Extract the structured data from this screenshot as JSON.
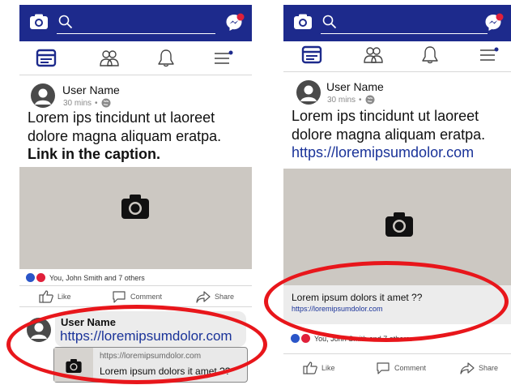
{
  "left": {
    "post": {
      "user_name": "User Name",
      "time": "30 mins",
      "dot": "•",
      "text_line1": "Lorem ips tincidunt ut laoreet",
      "text_line2": "dolore magna aliquam eratpa.",
      "caption_line": "Link in the caption.",
      "reactions": "You, John Smith and 7 others",
      "like_label": "Like",
      "comment_label": "Comment",
      "share_label": "Share"
    },
    "comment": {
      "user_name": "User Name",
      "link": "https://loremipsumdolor.com",
      "preview_url": "https://loremipsumdolor.com",
      "preview_title": "Lorem ipsum dolors it amet ??"
    }
  },
  "right": {
    "post": {
      "user_name": "User Name",
      "time": "30 mins",
      "dot": "•",
      "text_line1": "Lorem ips tincidunt ut laoreet",
      "text_line2": "dolore magna aliquam eratpa.",
      "link": "https://loremipsumdolor.com",
      "preview_title": "Lorem ipsum dolors it amet ??",
      "preview_url": "https://loremipsumdolor.com",
      "reactions": "You, John Smith and 7 others",
      "like_label": "Like",
      "comment_label": "Comment",
      "share_label": "Share"
    }
  },
  "icons": [
    "camera-icon",
    "search-icon",
    "messenger-icon",
    "news-feed-icon",
    "friends-icon",
    "notifications-icon",
    "menu-icon",
    "globe-icon",
    "like-icon",
    "comment-icon",
    "share-icon"
  ],
  "colors": {
    "top_bar": "#1d2a8c",
    "link": "#1a3399",
    "highlight_ring": "#e8161b",
    "photo_placeholder": "#ccc8c2",
    "notification_dot": "#e0203a"
  }
}
